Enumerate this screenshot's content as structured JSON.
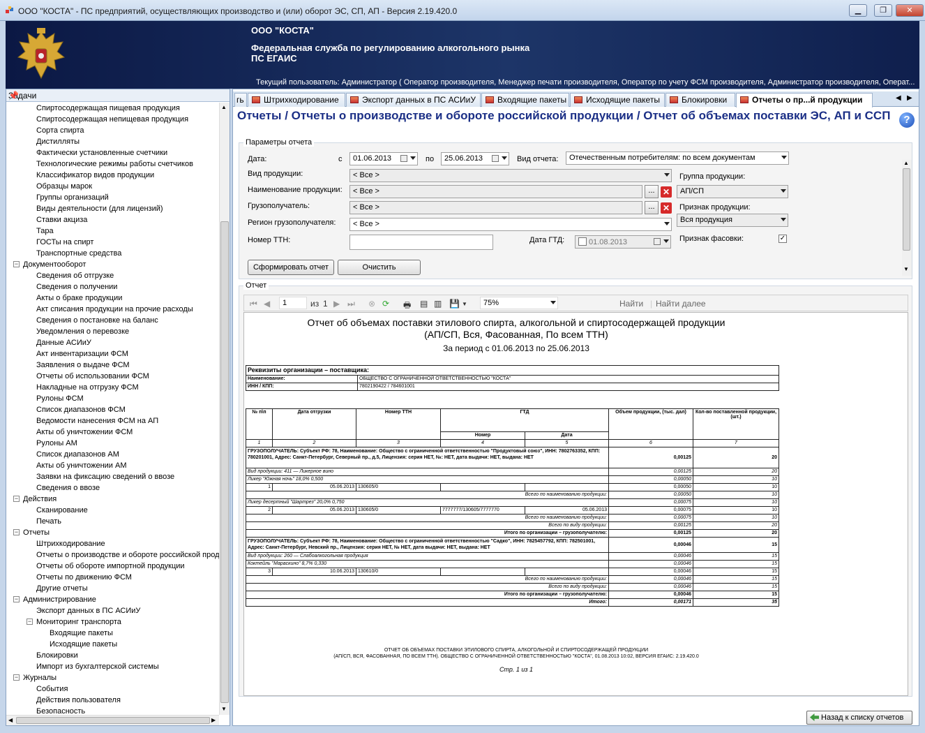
{
  "window": {
    "title": "ООО \"КОСТА\" - ПС предприятий, осуществляющих производство и (или) оборот ЭС, СП, АП - Версия 2.19.420.0"
  },
  "banner": {
    "org": "ООО \"КОСТА\"",
    "agency_line1": "Федеральная служба по регулированию алкогольного рынка",
    "agency_line2": "ПС ЕГАИС",
    "user": "Текущий пользователь: Администратор ( Оператор производителя, Менеджер печати производителя, Оператор по учету ФСМ производителя, Администратор производителя, Операт..."
  },
  "left_panel": {
    "title": "Задачи",
    "tree": [
      {
        "label": "Спиртосодержащая пищевая продукция",
        "level": 2
      },
      {
        "label": "Спиртосодержащая непищевая продукция",
        "level": 2
      },
      {
        "label": "Сорта спирта",
        "level": 2
      },
      {
        "label": "Дистилляты",
        "level": 2
      },
      {
        "label": "Фактически установленные счетчики",
        "level": 2
      },
      {
        "label": "Технологические режимы работы счетчиков",
        "level": 2
      },
      {
        "label": "Классификатор видов продукции",
        "level": 2
      },
      {
        "label": "Образцы марок",
        "level": 2
      },
      {
        "label": "Группы организаций",
        "level": 2
      },
      {
        "label": "Виды деятельности (для лицензий)",
        "level": 2
      },
      {
        "label": "Ставки акциза",
        "level": 2
      },
      {
        "label": "Тара",
        "level": 2
      },
      {
        "label": "ГОСТы на спирт",
        "level": 2
      },
      {
        "label": "Транспортные средства",
        "level": 2
      },
      {
        "label": "Документооборот",
        "level": 1,
        "expander": "−"
      },
      {
        "label": "Сведения об отгрузке",
        "level": 2
      },
      {
        "label": "Сведения о получении",
        "level": 2
      },
      {
        "label": "Акты о браке продукции",
        "level": 2
      },
      {
        "label": "Акт списания продукции на прочие расходы",
        "level": 2
      },
      {
        "label": "Сведения о постановке на баланс",
        "level": 2
      },
      {
        "label": "Уведомления о перевозке",
        "level": 2
      },
      {
        "label": "Данные АСИиУ",
        "level": 2
      },
      {
        "label": "Акт инвентаризации ФСМ",
        "level": 2
      },
      {
        "label": "Заявления о выдаче ФСМ",
        "level": 2
      },
      {
        "label": "Отчеты об использовании ФСМ",
        "level": 2
      },
      {
        "label": "Накладные на отгрузку ФСМ",
        "level": 2
      },
      {
        "label": "Рулоны ФСМ",
        "level": 2
      },
      {
        "label": "Список диапазонов ФСМ",
        "level": 2
      },
      {
        "label": "Ведомости нанесения ФСМ на АП",
        "level": 2
      },
      {
        "label": "Акты об уничтожении ФСМ",
        "level": 2
      },
      {
        "label": "Рулоны АМ",
        "level": 2
      },
      {
        "label": "Список диапазонов АМ",
        "level": 2
      },
      {
        "label": "Акты об уничтожении АМ",
        "level": 2
      },
      {
        "label": "Заявки на фиксацию сведений о ввозе",
        "level": 2
      },
      {
        "label": "Сведения о ввозе",
        "level": 2
      },
      {
        "label": "Действия",
        "level": 1,
        "expander": "−"
      },
      {
        "label": "Сканирование",
        "level": 2
      },
      {
        "label": "Печать",
        "level": 2
      },
      {
        "label": "Отчеты",
        "level": 1,
        "expander": "−"
      },
      {
        "label": "Штрихкодирование",
        "level": 2
      },
      {
        "label": "Отчеты о производстве и обороте российской прод",
        "level": 2
      },
      {
        "label": "Отчеты об обороте импортной продукции",
        "level": 2
      },
      {
        "label": "Отчеты по движению ФСМ",
        "level": 2
      },
      {
        "label": "Другие отчеты",
        "level": 2
      },
      {
        "label": "Администрирование",
        "level": 1,
        "expander": "−"
      },
      {
        "label": "Экспорт данных в ПС АСИиУ",
        "level": 2
      },
      {
        "label": "Мониторинг транспорта",
        "level": 2,
        "expander": "−"
      },
      {
        "label": "Входящие пакеты",
        "level": 3
      },
      {
        "label": "Исходящие пакеты",
        "level": 3
      },
      {
        "label": "Блокировки",
        "level": 2
      },
      {
        "label": "Импорт из бухгалтерской системы",
        "level": 2
      },
      {
        "label": "Журналы",
        "level": 1,
        "expander": "−"
      },
      {
        "label": "События",
        "level": 2
      },
      {
        "label": "Действия пользователя",
        "level": 2
      },
      {
        "label": "Безопасность",
        "level": 2
      }
    ]
  },
  "tabs": [
    {
      "label": "гь",
      "active": false
    },
    {
      "label": "Штрихкодирование",
      "active": false
    },
    {
      "label": "Экспорт данных в ПС АСИиУ",
      "active": false
    },
    {
      "label": "Входящие пакеты",
      "active": false
    },
    {
      "label": "Исходящие пакеты",
      "active": false
    },
    {
      "label": "Блокировки",
      "active": false
    },
    {
      "label": "Отчеты о пр...й продукции",
      "active": true
    }
  ],
  "page_title": "Отчеты / Отчеты о производстве и обороте российской продукции / Отчет об объемах поставки ЭС, АП и ССП",
  "params": {
    "group_label": "Параметры отчета",
    "date_label": "Дата:",
    "from_label": "с",
    "date_from": "01.06.2013",
    "to_label": "по",
    "date_to": "25.06.2013",
    "report_type_label": "Вид отчета:",
    "report_type": "Отечественным потребителям: по всем документам",
    "product_kind_label": "Вид продукции:",
    "product_kind": "< Все >",
    "product_name_label": "Наименование продукции:",
    "product_name": "< Все >",
    "consignee_label": "Грузополучатель:",
    "consignee": "< Все >",
    "region_label": "Регион грузополучателя:",
    "region": "< Все >",
    "ttn_label": "Номер ТТН:",
    "ttn": "",
    "gtd_date_label": "Дата ГТД:",
    "gtd_date": "01.08.2013",
    "product_group_label": "Группа продукции:",
    "product_group": "АП/СП",
    "product_attr_label": "Признак продукции:",
    "product_attr": "Вся продукция",
    "packing_label": "Признак фасовки:",
    "packing_checked": "✓",
    "browse": "...",
    "clear_x": "✕",
    "generate_btn": "Сформировать отчет",
    "clear_btn": "Очистить"
  },
  "report": {
    "group_label": "Отчет",
    "toolbar": {
      "page": "1",
      "of": "из",
      "total": "1",
      "zoom": "75%",
      "find": "Найти",
      "find_next": "Найти далее"
    },
    "title1": "Отчет об объемах поставки этилового спирта, алкогольной и спиртосодержащей продукции",
    "title2": "(АП/СП, Вся, Фасованная, По всем ТТН)",
    "period": "За период с 01.06.2013 по 25.06.2013",
    "org_header": "Реквизиты организации – поставщика:",
    "org_name_label": "Наименование:",
    "org_name": "ОБЩЕСТВО С ОГРАНИЧЕННОЙ ОТВЕТСТВЕННОСТЬЮ \"КОСТА\"",
    "org_inn_label": "ИНН / КПП:",
    "org_inn": "7802190422 / 784601001",
    "cols": {
      "n": "№ п\\п",
      "date": "Дата отгрузки",
      "ttn": "Номер ТТН",
      "gtd": "ГТД",
      "gtd_num": "Номер",
      "gtd_date": "Дата",
      "vol": "Объем продукции, (тыс. дал)",
      "qty": "Кол-во поставленной продукции, (шт.)",
      "c1": "1",
      "c2": "2",
      "c3": "3",
      "c4": "4",
      "c5": "5",
      "c6": "6",
      "c7": "7"
    },
    "rows": {
      "r1": "ГРУЗОПОЛУЧАТЕЛЬ: Субъект РФ: 78, Наименование: Общество с ограниченной ответственностью \"Продуктовый союз\", ИНН: 7802763352, КПП: 780201001, Адрес: Санкт-Петербург, Северный пр., д.5, Лицензия: серия НЕТ, №: НЕТ, дата выдачи: НЕТ, выдана: НЕТ",
      "r1v": "0,00125",
      "r1q": "20",
      "r2": "Вид продукции: 411 — Ликерное вино",
      "r2v": "0,00125",
      "r2q": "20",
      "r3": "Ликер \"Южная ночь\" 18,0% 0,500",
      "r3v": "0,00050",
      "r3q": "10",
      "r4n": "1",
      "r4d": "05.06.2013",
      "r4t": "130605/0",
      "r4v": "0,00050",
      "r4q": "10",
      "r5": "Всего по наименованию продукции:",
      "r5v": "0,00050",
      "r5q": "10",
      "r6": "Ликер десертный \"Шартрез\" 20,0% 0,750",
      "r6v": "0,00075",
      "r6q": "10",
      "r7n": "2",
      "r7d": "05.06.2013",
      "r7t": "130605/0",
      "r7g": "7777777/130605/7777770",
      "r7gd": "05.06.2013",
      "r7v": "0,00075",
      "r7q": "10",
      "r8": "Всего по наименованию продукции:",
      "r8v": "0,00075",
      "r8q": "10",
      "r9": "Всего по виду продукции:",
      "r9v": "0,00125",
      "r9q": "20",
      "r10": "Итого по организации – грузополучателю:",
      "r10v": "0,00125",
      "r10q": "20",
      "r11": "ГРУЗОПОЛУЧАТЕЛЬ: Субъект РФ: 78, Наименование: Общество с ограниченной ответственностью \"Садко\", ИНН: 7825457792, КПП: 782501001, Адрес: Санкт-Петербург, Невский пр., Лицензия: серия НЕТ, № НЕТ, дата выдачи: НЕТ, выдана: НЕТ",
      "r11v": "0,00046",
      "r11q": "15",
      "r12": "Вид продукции: 260 — Слабоалкогольная продукция",
      "r12v": "0,00046",
      "r12q": "15",
      "r13": "Коктейль \"Мараскино\" 8,7% 0,330",
      "r13v": "0,00046",
      "r13q": "15",
      "r14n": "3",
      "r14d": "10.06.2013",
      "r14t": "130610/0",
      "r14v": "0,00046",
      "r14q": "15",
      "r15": "Всего по наименованию продукции:",
      "r15v": "0,00046",
      "r15q": "15",
      "r16": "Всего по виду продукции:",
      "r16v": "0,00046",
      "r16q": "15",
      "r17": "Итого по организации – грузополучателю:",
      "r17v": "0,00046",
      "r17q": "15",
      "r18": "Итого:",
      "r18v": "0,00171",
      "r18q": "35"
    },
    "footer1": "ОТЧЕТ ОБ ОБЪЕМАХ ПОСТАВКИ ЭТИЛОВОГО СПИРТА, АЛКОГОЛЬНОЙ И СПИРТОСОДЕРЖАЩЕЙ ПРОДУКЦИИ",
    "footer2": "(АП/СП, ВСЯ, ФАСОВАННАЯ, ПО ВСЕМ ТТН). ОБЩЕСТВО С ОГРАНИЧЕННОЙ ОТВЕТСТВЕННОСТЬЮ \"КОСТА\", 01.08.2013 10:02, ВЕРСИЯ ЕГАИС: 2.19.420.0",
    "page_num": "Стр. 1 из 1"
  },
  "back_button": "Назад к списку отчетов"
}
